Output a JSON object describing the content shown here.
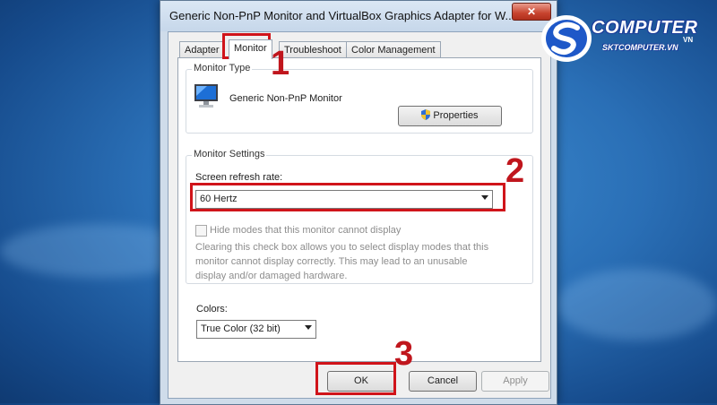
{
  "window": {
    "title": "Generic Non-PnP Monitor and VirtualBox Graphics Adapter for W...",
    "close_label": "✕"
  },
  "tabs": [
    {
      "label": "Adapter",
      "active": false
    },
    {
      "label": "Monitor",
      "active": true
    },
    {
      "label": "Troubleshoot",
      "active": false
    },
    {
      "label": "Color Management",
      "active": false
    }
  ],
  "monitor_type": {
    "group_label": "Monitor Type",
    "monitor_name": "Generic Non-PnP Monitor",
    "properties_label": "Properties",
    "icon": "monitor-icon"
  },
  "monitor_settings": {
    "group_label": "Monitor Settings",
    "refresh_label": "Screen refresh rate:",
    "refresh_value": "60 Hertz",
    "hide_modes_label": "Hide modes that this monitor cannot display",
    "hide_modes_checked": false,
    "note_lines": [
      "Clearing this check box allows you to select display modes that this",
      "monitor cannot display correctly. This may lead to an unusable",
      "display and/or damaged hardware."
    ]
  },
  "colors": {
    "label": "Colors:",
    "value": "True Color (32 bit)"
  },
  "buttons": {
    "ok": "OK",
    "cancel": "Cancel",
    "apply": "Apply"
  },
  "annotations": {
    "step1": "1",
    "step2": "2",
    "step3": "3",
    "color": "#d0141a"
  },
  "logo": {
    "text": "COMPUTER",
    "sub": "SKTCOMPUTER.VN",
    "tag": "VN"
  }
}
